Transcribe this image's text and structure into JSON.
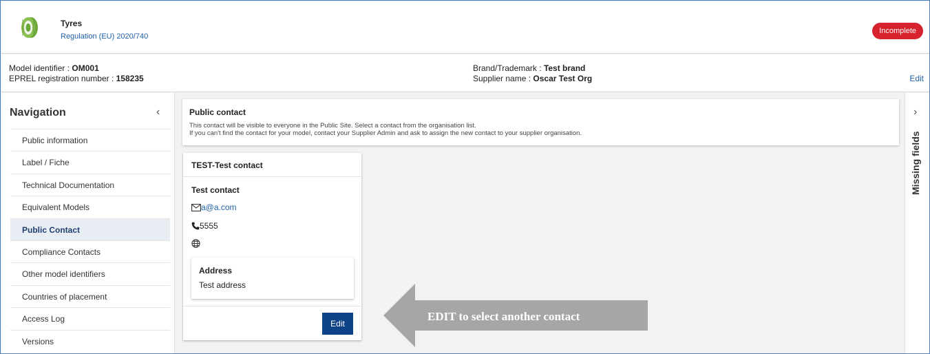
{
  "header": {
    "product": "Tyres",
    "regulation": "Regulation (EU) 2020/740",
    "status": "Incomplete"
  },
  "model": {
    "identifier_label": "Model identifier : ",
    "identifier_value": "OM001",
    "registration_label": "EPREL registration number : ",
    "registration_value": "158235",
    "brand_label": "Brand/Trademark : ",
    "brand_value": "Test brand",
    "supplier_label": "Supplier name : ",
    "supplier_value": "Oscar Test Org",
    "edit": "Edit"
  },
  "nav": {
    "title": "Navigation",
    "collapse_icon": "‹",
    "items": [
      {
        "label": "Public information"
      },
      {
        "label": "Label / Fiche"
      },
      {
        "label": "Technical Documentation"
      },
      {
        "label": "Equivalent Models"
      },
      {
        "label": "Public Contact"
      },
      {
        "label": "Compliance Contacts"
      },
      {
        "label": "Other model identifiers"
      },
      {
        "label": "Countries of placement"
      },
      {
        "label": "Access Log"
      },
      {
        "label": "Versions"
      }
    ],
    "active_index": 4
  },
  "notice": {
    "title": "Public contact",
    "line1": "This contact will be visible to everyone in the Public Site. Select a contact from the organisation list.",
    "line2": "If you can't find the contact for your model, contact your Supplier Admin and ask to assign the new contact to your supplier organisation."
  },
  "contact_card": {
    "header": "TEST-Test contact",
    "name": "Test contact",
    "email": "a@a.com",
    "phone": "5555",
    "address_title": "Address",
    "address": "Test address",
    "edit_button": "Edit"
  },
  "annotation": {
    "text": "EDIT to select another contact"
  },
  "right_panel": {
    "label": "Missing fields",
    "chevron": "›"
  },
  "colors": {
    "link": "#1f5fa8",
    "badge": "#d7232d",
    "primary_button": "#0e4487",
    "active_nav_bg": "#e8edf3",
    "arrow": "#a6a6a6"
  }
}
